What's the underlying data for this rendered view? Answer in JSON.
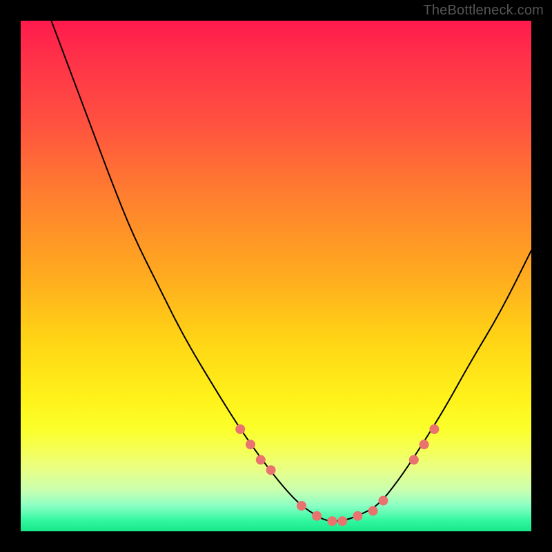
{
  "watermark": "TheBottleneck.com",
  "chart_data": {
    "type": "line",
    "title": "",
    "xlabel": "",
    "ylabel": "",
    "xlim": [
      0,
      100
    ],
    "ylim": [
      0,
      100
    ],
    "series": [
      {
        "name": "bottleneck-curve",
        "x": [
          6,
          9,
          12,
          15,
          18,
          22,
          27,
          32,
          38,
          43,
          48,
          52,
          55,
          58,
          60,
          63,
          66,
          70,
          74,
          78,
          83,
          88,
          94,
          100
        ],
        "y": [
          100,
          92,
          84,
          76,
          68,
          58,
          48,
          38,
          28,
          20,
          13,
          8,
          5,
          3,
          2,
          2,
          3,
          5,
          10,
          16,
          24,
          33,
          43,
          55
        ]
      }
    ],
    "markers": {
      "name": "highlight-dots",
      "color": "#e8736f",
      "x": [
        43,
        45,
        47,
        49,
        55,
        58,
        61,
        63,
        66,
        69,
        71,
        77,
        79,
        81
      ],
      "y": [
        20,
        17,
        14,
        12,
        5,
        3,
        2,
        2,
        3,
        4,
        6,
        14,
        17,
        20
      ]
    }
  }
}
